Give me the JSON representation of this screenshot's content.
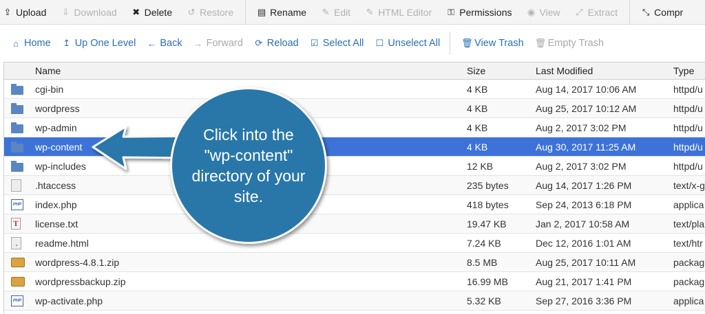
{
  "toolbar": [
    {
      "label": "Upload",
      "icon": "upload-icon",
      "glyph": "⇪",
      "disabled": false
    },
    {
      "label": "Download",
      "icon": "download-icon",
      "glyph": "⇩",
      "disabled": true
    },
    {
      "label": "Delete",
      "icon": "delete-icon",
      "glyph": "✖",
      "disabled": false
    },
    {
      "label": "Restore",
      "icon": "restore-icon",
      "glyph": "↺",
      "disabled": true
    },
    {
      "label": "Rename",
      "icon": "rename-icon",
      "glyph": "▤",
      "disabled": false
    },
    {
      "label": "Edit",
      "icon": "edit-icon",
      "glyph": "✎",
      "disabled": true
    },
    {
      "label": "HTML Editor",
      "icon": "html-editor-icon",
      "glyph": "✎",
      "disabled": true
    },
    {
      "label": "Permissions",
      "icon": "key-icon",
      "glyph": "⚿",
      "disabled": false
    },
    {
      "label": "View",
      "icon": "eye-icon",
      "glyph": "◉",
      "disabled": true
    },
    {
      "label": "Extract",
      "icon": "extract-icon",
      "glyph": "⤢",
      "disabled": true
    },
    {
      "label": "Compr",
      "icon": "compress-icon",
      "glyph": "⤡",
      "disabled": false
    }
  ],
  "nav": [
    {
      "label": "Home",
      "icon": "home-icon",
      "glyph": "⌂",
      "disabled": false
    },
    {
      "label": "Up One Level",
      "icon": "level-up-icon",
      "glyph": "↥",
      "disabled": false
    },
    {
      "label": "Back",
      "icon": "back-arrow-icon",
      "glyph": "←",
      "disabled": false
    },
    {
      "label": "Forward",
      "icon": "forward-arrow-icon",
      "glyph": "→",
      "disabled": true
    },
    {
      "label": "Reload",
      "icon": "reload-icon",
      "glyph": "⟳",
      "disabled": false
    },
    {
      "label": "Select All",
      "icon": "checkbox-checked-icon",
      "glyph": "☑",
      "disabled": false
    },
    {
      "label": "Unselect All",
      "icon": "checkbox-empty-icon",
      "glyph": "☐",
      "disabled": false
    },
    {
      "label": "View Trash",
      "icon": "trash-icon",
      "glyph": "🗑",
      "disabled": false
    },
    {
      "label": "Empty Trash",
      "icon": "empty-trash-icon",
      "glyph": "🗑",
      "disabled": true
    }
  ],
  "table": {
    "columns": {
      "name": "Name",
      "size": "Size",
      "modified": "Last Modified",
      "type": "Type"
    },
    "rows": [
      {
        "icon": "folder",
        "name": "cgi-bin",
        "size": "4 KB",
        "modified": "Aug 14, 2017 10:06 AM",
        "type": "httpd/u"
      },
      {
        "icon": "folder",
        "name": "wordpress",
        "size": "4 KB",
        "modified": "Aug 25, 2017 10:12 AM",
        "type": "httpd/u"
      },
      {
        "icon": "folder",
        "name": "wp-admin",
        "size": "4 KB",
        "modified": "Aug 2, 2017 3:02 PM",
        "type": "httpd/u"
      },
      {
        "icon": "folder",
        "name": "wp-content",
        "size": "4 KB",
        "modified": "Aug 30, 2017 11:25 AM",
        "type": "httpd/u",
        "selected": true
      },
      {
        "icon": "folder",
        "name": "wp-includes",
        "size": "12 KB",
        "modified": "Aug 2, 2017 3:02 PM",
        "type": "httpd/u"
      },
      {
        "icon": "doc",
        "name": ".htaccess",
        "size": "235 bytes",
        "modified": "Aug 14, 2017 1:26 PM",
        "type": "text/x-g"
      },
      {
        "icon": "php",
        "name": "index.php",
        "size": "418 bytes",
        "modified": "Sep 24, 2013 6:18 PM",
        "type": "applica"
      },
      {
        "icon": "txt",
        "name": "license.txt",
        "size": "19.47 KB",
        "modified": "Jan 2, 2017 10:58 AM",
        "type": "text/pla"
      },
      {
        "icon": "html",
        "name": "readme.html",
        "size": "7.24 KB",
        "modified": "Dec 12, 2016 1:01 AM",
        "type": "text/htr"
      },
      {
        "icon": "zip",
        "name": "wordpress-4.8.1.zip",
        "size": "8.5 MB",
        "modified": "Aug 25, 2017 10:11 AM",
        "type": "packag"
      },
      {
        "icon": "zip",
        "name": "wordpressbackup.zip",
        "size": "16.99 MB",
        "modified": "Aug 21, 2017 1:41 PM",
        "type": "packag"
      },
      {
        "icon": "php",
        "name": "wp-activate.php",
        "size": "5.32 KB",
        "modified": "Sep 27, 2016 3:36 PM",
        "type": "applica"
      }
    ]
  },
  "callout": {
    "text": "Click into the \"wp-content\" directory of your site."
  },
  "colors": {
    "selected_row": "#3d73d8",
    "callout": "#2977a9",
    "link": "#2a6fb5"
  }
}
